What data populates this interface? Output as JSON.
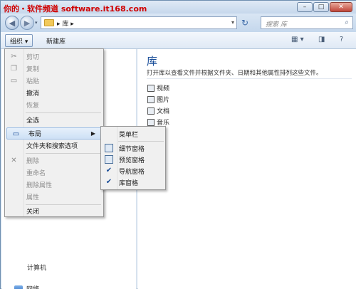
{
  "watermark": "你的・软件频道 software.it168.com",
  "window_buttons": {
    "minimize": "–",
    "maximize": "□",
    "close": "✕"
  },
  "address": {
    "path": "▸ 库 ▸",
    "dropdown": "▾",
    "refresh": "↻",
    "search_placeholder": "搜索 库"
  },
  "toolbar": {
    "organize": "组织 ▾",
    "new_library": "新建库"
  },
  "content": {
    "title": "库",
    "description": "打开库以查看文件并根据文件夹、日期和其他属性排列这些文件。",
    "libraries": [
      "视频",
      "图片",
      "文档",
      "音乐"
    ]
  },
  "nav": {
    "computer_fragment": "计算机",
    "network": "网络"
  },
  "organize_menu": {
    "cut": "剪切",
    "copy": "复制",
    "paste": "粘贴",
    "undo": "撤消",
    "redo": "恢复",
    "select_all": "全选",
    "layout": "布局",
    "folder_options": "文件夹和搜索选项",
    "delete": "删除",
    "rename": "重命名",
    "remove_properties": "删除属性",
    "properties": "属性",
    "close": "关闭"
  },
  "layout_submenu": {
    "menu_bar": "菜单栏",
    "details_pane": "细节窗格",
    "preview_pane": "预览窗格",
    "navigation_pane": "导航窗格",
    "library_pane": "库窗格",
    "check": "✔"
  },
  "colors": {
    "title_accent": "#1b4f9a",
    "watermark": "#d00000",
    "frame": "#cfdfef"
  }
}
